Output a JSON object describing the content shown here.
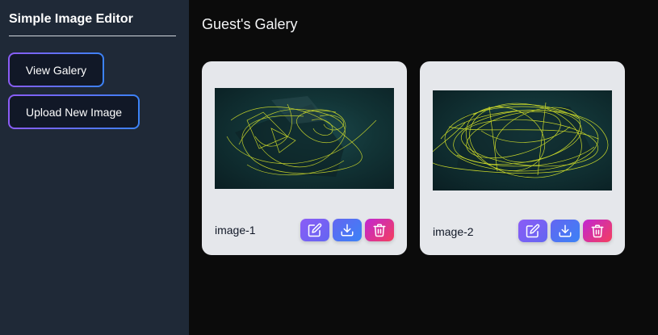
{
  "app": {
    "title": "Simple Image Editor"
  },
  "sidebar": {
    "buttons": [
      {
        "label": "View Galery"
      },
      {
        "label": "Upload New Image"
      }
    ]
  },
  "main": {
    "title": "Guest's Galery",
    "images": [
      {
        "name": "image-1"
      },
      {
        "name": "image-2"
      }
    ]
  },
  "icons": {
    "edit": "pencil-square-icon",
    "download": "download-icon",
    "delete": "trash-icon"
  },
  "colors": {
    "sidebar_bg": "#1f2937",
    "page_bg": "#0b0b0b",
    "card_bg": "#e5e7eb",
    "accent_start": "#8b5cf6",
    "accent_end": "#3b82f6",
    "danger_end": "#f43f5e",
    "scribble": "#d4e22a"
  }
}
